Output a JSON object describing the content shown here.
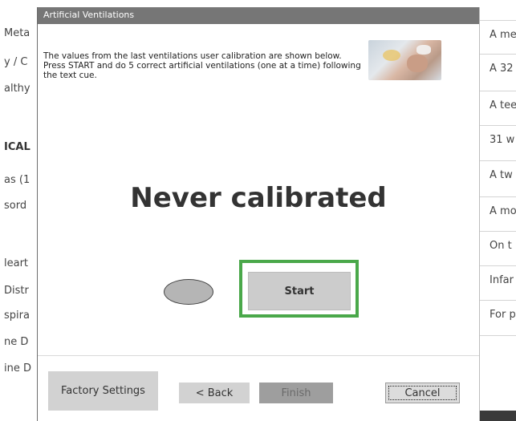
{
  "background_left": {
    "rows": [
      {
        "text": "Meta",
        "bold": false
      },
      {
        "text": "y / C",
        "bold": false
      },
      {
        "text": "althy",
        "bold": false
      },
      {
        "text": "ICAL",
        "bold": true
      },
      {
        "text": "as (1",
        "bold": false
      },
      {
        "text": "sord",
        "bold": false
      },
      {
        "text": "leart",
        "bold": false
      },
      {
        "text": "Distr",
        "bold": false
      },
      {
        "text": "spira",
        "bold": false
      },
      {
        "text": "ne D",
        "bold": false
      },
      {
        "text": "ine D",
        "bold": false
      }
    ]
  },
  "background_right": {
    "cells": [
      "A me",
      "A 32",
      "A tee",
      "31 w",
      "A tw",
      "A mo",
      "On t",
      "Infar",
      "For p"
    ]
  },
  "dialog": {
    "title": "Artificial Ventilations",
    "instructions": "The values from the last ventilations user calibration are shown below.  Press START and do 5 correct artificial ventilations (one at a time) following the text cue.",
    "status": "Never calibrated",
    "start_label": "Start",
    "buttons": {
      "factory": "Factory Settings",
      "back": "< Back",
      "finish": "Finish",
      "cancel": "Cancel"
    }
  },
  "colors": {
    "titlebar": "#767676",
    "highlight": "#4aa84a",
    "button": "#d2d2d2",
    "finish_disabled": "#9e9e9e"
  }
}
